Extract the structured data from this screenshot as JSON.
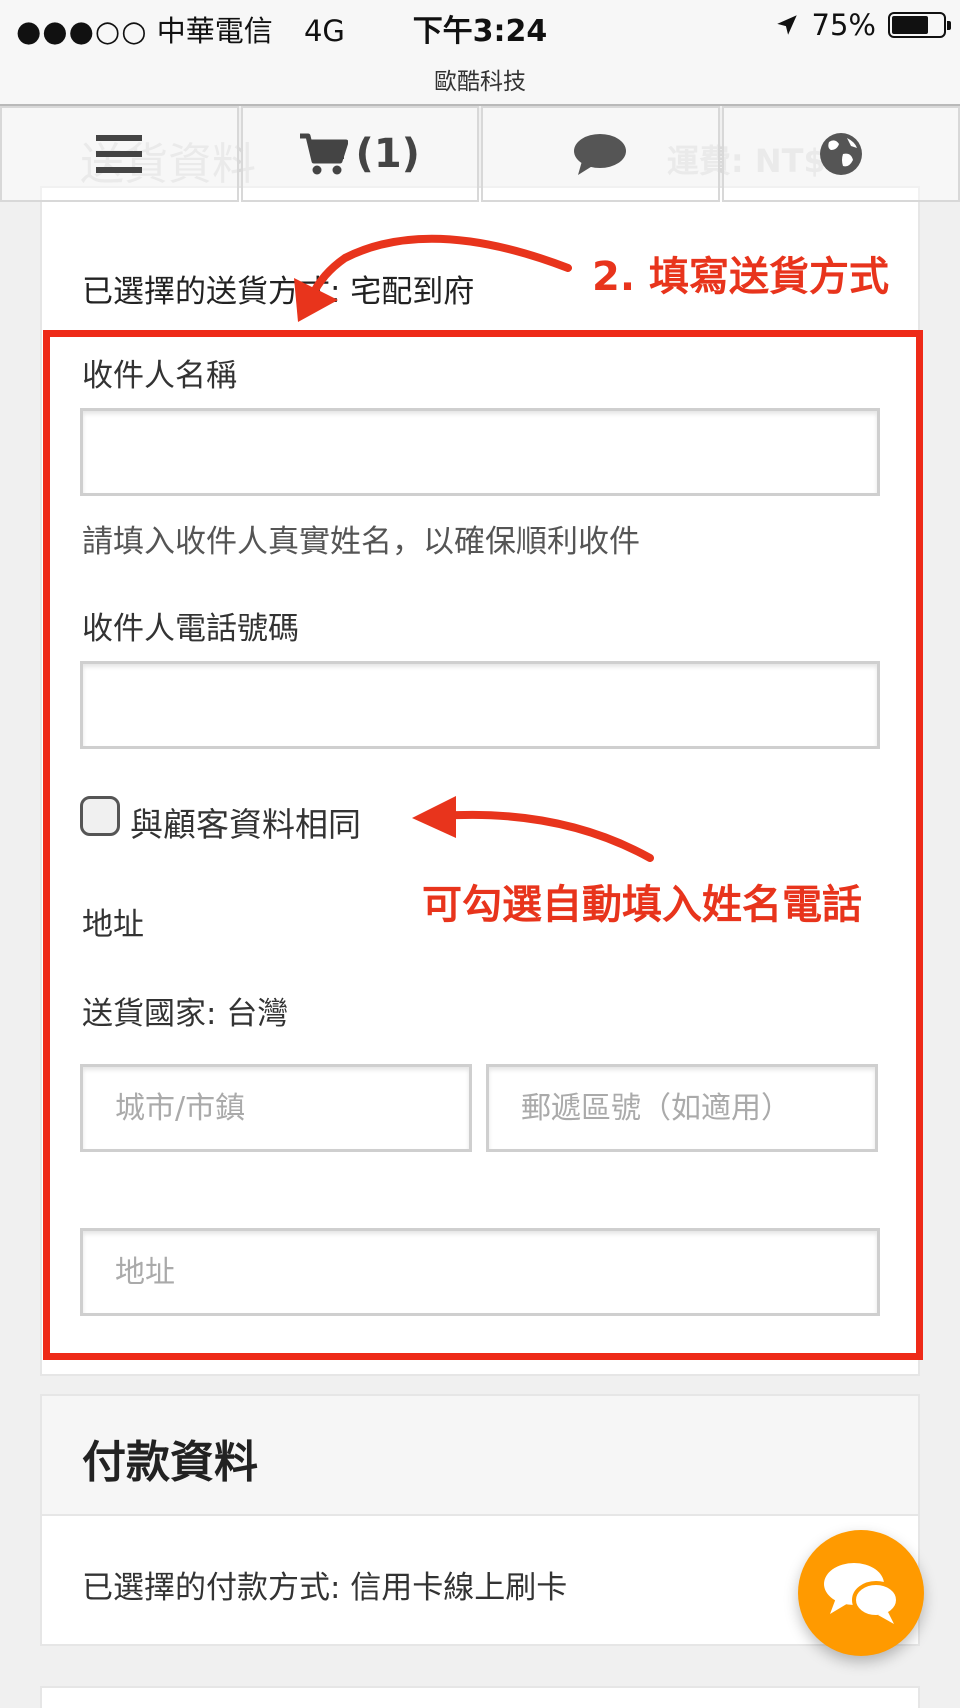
{
  "status_bar": {
    "signal": "●●●○○",
    "carrier": "中華電信",
    "network": "4G",
    "time": "下午3:24",
    "battery": "75%",
    "battery_level": 0.75
  },
  "app_subtitle": "歐酷科技",
  "nav": {
    "menu_icon": "hamburger-menu-icon",
    "cart_icon": "cart-icon",
    "cart_count": "(1)",
    "chat_icon": "speech-bubble-icon",
    "globe_icon": "globe-icon"
  },
  "shipping": {
    "section_title_ghost": "送貨資料",
    "fee_ghost": "運費: NT$0",
    "selected_method": "已選擇的送貨方式: 宅配到府",
    "recipient_name_label": "收件人名稱",
    "recipient_name_value": "",
    "recipient_name_hint": "請填入收件人真實姓名，以確保順利收件",
    "recipient_phone_label": "收件人電話號碼",
    "recipient_phone_value": "",
    "same_as_customer_label": "與顧客資料相同",
    "same_as_customer_checked": false,
    "address_label": "地址",
    "country": "送貨國家: 台灣",
    "city_placeholder": "城市/市鎮",
    "postal_placeholder": "郵遞區號（如適用）",
    "address_placeholder": "地址"
  },
  "annotations": {
    "note_fill_shipping": "2. 填寫送貨方式",
    "note_autofill": "可勾選自動填入姓名電話",
    "accent_color": "#ee2a18"
  },
  "payment": {
    "section_title": "付款資料",
    "selected_method": "已選擇的付款方式: 信用卡線上刷卡"
  },
  "fab": {
    "icon": "chat-bubbles-icon",
    "color": "#ff9a00"
  }
}
